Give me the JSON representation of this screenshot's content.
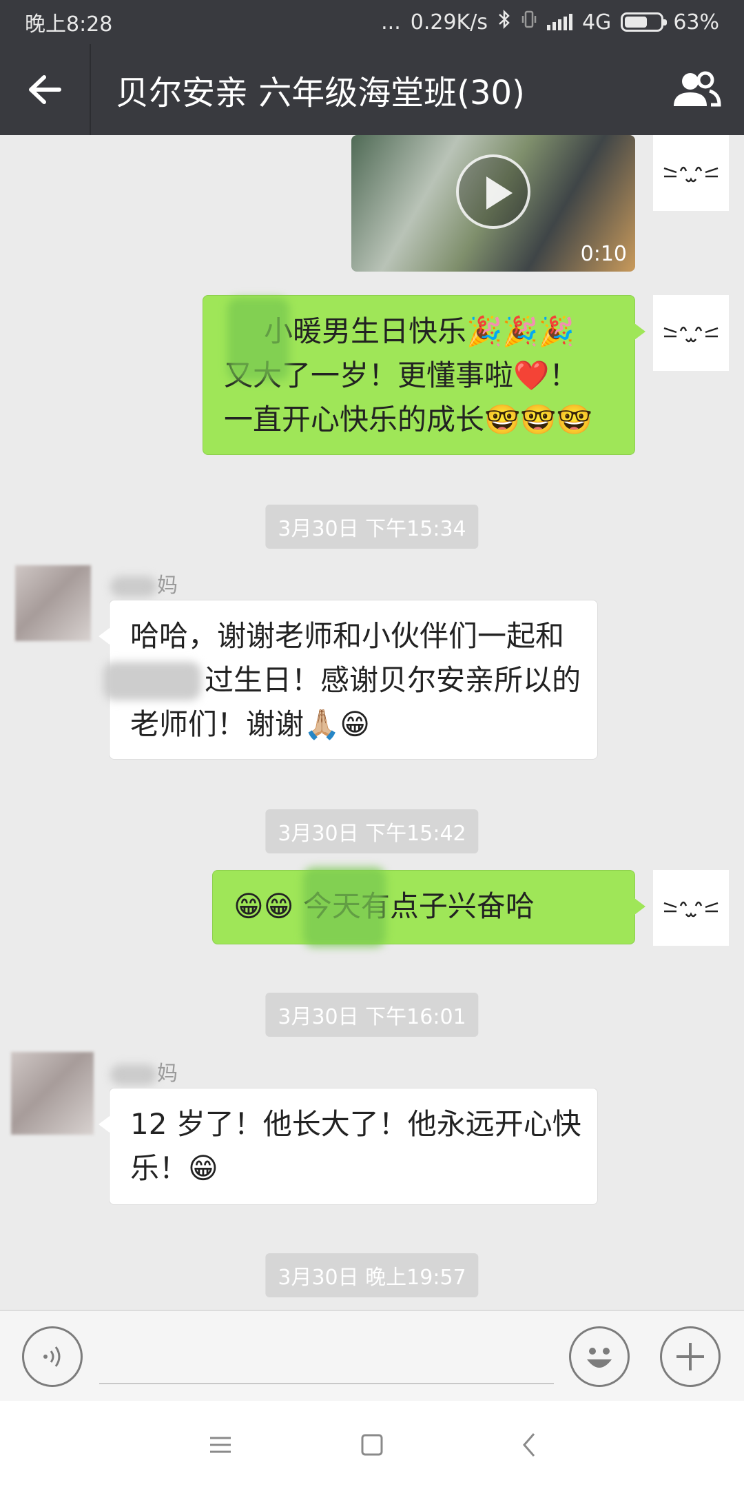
{
  "status_bar": {
    "time": "晚上8:28",
    "dots": "...",
    "speed": "0.29K/s",
    "network": "4G",
    "battery_percent": "63%",
    "battery_level": 0.63,
    "icons": [
      "bluetooth-icon",
      "vibrate-icon",
      "signal-icon",
      "battery-icon"
    ]
  },
  "header": {
    "title": "贝尔安亲 六年级海堂班(30)",
    "back_icon": "arrow-left-icon",
    "members_icon": "group-icon"
  },
  "messages": {
    "video": {
      "duration": "0:10"
    },
    "msg1": {
      "line1": "小暖男生日快乐🎉🎉🎉",
      "line2": "又大了一岁！更懂事啦❤️！",
      "line3": "一直开心快乐的成长🤓🤓🤓"
    },
    "ts1": "3月30日 下午15:34",
    "msg2": {
      "sender_suffix": "妈",
      "line1": "哈哈，谢谢老师和小伙伴们一起和",
      "line2": "过生日！感谢贝尔安亲所以的",
      "line3": "老师们！谢谢🙏🏼😁"
    },
    "ts2": "3月30日 下午15:42",
    "msg3": {
      "text": "😁😁 今天有点子兴奋哈"
    },
    "ts3": "3月30日 下午16:01",
    "msg4": {
      "sender_suffix": "妈",
      "line1": "12 岁了！他长大了！他永远开心快",
      "line2": "乐！😁"
    },
    "ts4": "3月30日 晚上19:57"
  },
  "input_bar": {
    "voice_icon": "voice-icon",
    "emoji_icon": "smiley-icon",
    "more_icon": "plus-icon"
  },
  "nav_bar": {
    "icons": [
      "menu-icon",
      "home-icon",
      "back-icon"
    ]
  },
  "colors": {
    "header_bg": "#393a3f",
    "chat_bg": "#ebebeb",
    "sent_bubble": "#9fe658",
    "received_bubble": "#ffffff"
  }
}
